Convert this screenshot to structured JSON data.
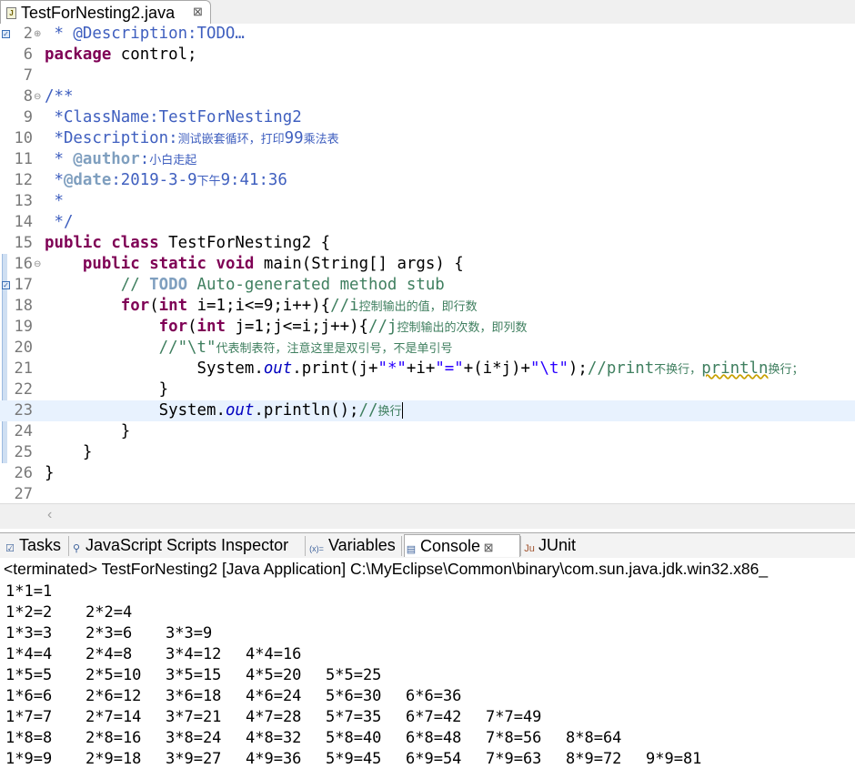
{
  "editor": {
    "tab": {
      "title": "TestForNesting2.java",
      "close": "⊠"
    },
    "lines": [
      {
        "num": "2",
        "fold": "⊕",
        "marker": "task",
        "tokens": [
          {
            "t": " * @Description:TODO",
            "c": "jd"
          },
          {
            "t": "…",
            "c": "jd"
          }
        ]
      },
      {
        "num": "6",
        "tokens": [
          {
            "t": "package",
            "c": "kw"
          },
          {
            "t": " control;",
            "c": ""
          }
        ]
      },
      {
        "num": "7",
        "tokens": []
      },
      {
        "num": "8",
        "fold": "⊖",
        "tokens": [
          {
            "t": "/**",
            "c": "jd"
          }
        ]
      },
      {
        "num": "9",
        "tokens": [
          {
            "t": " *ClassName:TestForNesting2",
            "c": "jd"
          }
        ]
      },
      {
        "num": "10",
        "tokens": [
          {
            "t": " *Description:",
            "c": "jd"
          },
          {
            "t": "测试嵌套循环，打印",
            "c": "jd small"
          },
          {
            "t": "99",
            "c": "jd"
          },
          {
            "t": "乘法表",
            "c": "jd small"
          }
        ]
      },
      {
        "num": "11",
        "tokens": [
          {
            "t": " * ",
            "c": "jd"
          },
          {
            "t": "@author",
            "c": "jdt"
          },
          {
            "t": ":",
            "c": "jd"
          },
          {
            "t": "小白走起",
            "c": "jd small"
          }
        ]
      },
      {
        "num": "12",
        "tokens": [
          {
            "t": " *",
            "c": "jd"
          },
          {
            "t": "@date",
            "c": "jdt"
          },
          {
            "t": ":2019-3-9",
            "c": "jd"
          },
          {
            "t": "下午",
            "c": "jd small"
          },
          {
            "t": "9:41:36",
            "c": "jd"
          }
        ]
      },
      {
        "num": "13",
        "tokens": [
          {
            "t": " *",
            "c": "jd"
          }
        ]
      },
      {
        "num": "14",
        "tokens": [
          {
            "t": " */",
            "c": "jd"
          }
        ]
      },
      {
        "num": "15",
        "tokens": [
          {
            "t": "public",
            "c": "kw"
          },
          {
            "t": " ",
            "c": ""
          },
          {
            "t": "class",
            "c": "kw"
          },
          {
            "t": " TestForNesting2 {",
            "c": ""
          }
        ]
      },
      {
        "num": "16",
        "fold": "⊖",
        "tokens": [
          {
            "t": "    ",
            "c": ""
          },
          {
            "t": "public",
            "c": "kw"
          },
          {
            "t": " ",
            "c": ""
          },
          {
            "t": "static",
            "c": "kw"
          },
          {
            "t": " ",
            "c": ""
          },
          {
            "t": "void",
            "c": "kw"
          },
          {
            "t": " main(String[] args) {",
            "c": ""
          }
        ]
      },
      {
        "num": "17",
        "marker": "task",
        "tokens": [
          {
            "t": "        // ",
            "c": "cm"
          },
          {
            "t": "TODO",
            "c": "jdt"
          },
          {
            "t": " Auto-generated method stub",
            "c": "cm"
          }
        ]
      },
      {
        "num": "18",
        "tokens": [
          {
            "t": "        ",
            "c": ""
          },
          {
            "t": "for",
            "c": "kw"
          },
          {
            "t": "(",
            "c": ""
          },
          {
            "t": "int",
            "c": "kw"
          },
          {
            "t": " i=1;i<=9;i++){",
            "c": ""
          },
          {
            "t": "//i",
            "c": "cm"
          },
          {
            "t": "控制输出的值，即行数",
            "c": "cm small"
          }
        ]
      },
      {
        "num": "19",
        "tokens": [
          {
            "t": "            ",
            "c": ""
          },
          {
            "t": "for",
            "c": "kw"
          },
          {
            "t": "(",
            "c": ""
          },
          {
            "t": "int",
            "c": "kw"
          },
          {
            "t": " j=1;j<=i;j++){",
            "c": ""
          },
          {
            "t": "//j",
            "c": "cm"
          },
          {
            "t": "控制输出的次数，即列数",
            "c": "cm small"
          }
        ]
      },
      {
        "num": "20",
        "tokens": [
          {
            "t": "            //\"\\t\"",
            "c": "cm"
          },
          {
            "t": "代表制表符，注意这里是双引号，不是单引号",
            "c": "cm small"
          }
        ]
      },
      {
        "num": "21",
        "tokens": [
          {
            "t": "                System.",
            "c": ""
          },
          {
            "t": "out",
            "c": "fi"
          },
          {
            "t": ".print(j+",
            "c": ""
          },
          {
            "t": "\"*\"",
            "c": "st"
          },
          {
            "t": "+i+",
            "c": ""
          },
          {
            "t": "\"=\"",
            "c": "st"
          },
          {
            "t": "+(i*j)+",
            "c": ""
          },
          {
            "t": "\"\\t\"",
            "c": "st"
          },
          {
            "t": ");",
            "c": ""
          },
          {
            "t": "//print",
            "c": "cm"
          },
          {
            "t": "不换行，",
            "c": "cm small"
          },
          {
            "t": "println",
            "c": "cm wavy"
          },
          {
            "t": "换行；",
            "c": "cm small"
          }
        ]
      },
      {
        "num": "22",
        "tokens": [
          {
            "t": "            }",
            "c": ""
          }
        ]
      },
      {
        "num": "23",
        "current": true,
        "tokens": [
          {
            "t": "            System.",
            "c": ""
          },
          {
            "t": "out",
            "c": "fi"
          },
          {
            "t": ".println();",
            "c": ""
          },
          {
            "t": "//",
            "c": "cm"
          },
          {
            "t": "换行",
            "c": "cm small"
          }
        ]
      },
      {
        "num": "24",
        "tokens": [
          {
            "t": "        }",
            "c": ""
          }
        ]
      },
      {
        "num": "25",
        "tokens": [
          {
            "t": "    }",
            "c": ""
          }
        ]
      },
      {
        "num": "26",
        "tokens": [
          {
            "t": "}",
            "c": ""
          }
        ]
      },
      {
        "num": "27",
        "tokens": []
      }
    ]
  },
  "views": {
    "tabs": [
      {
        "label": "Tasks",
        "icon": "tasks-icon",
        "glyph": "☑"
      },
      {
        "label": "JavaScript Scripts Inspector",
        "icon": "script-icon",
        "glyph": "⚲"
      },
      {
        "label": "Variables",
        "icon": "variables-icon",
        "glyph": "(x)="
      },
      {
        "label": "Console",
        "icon": "console-icon",
        "glyph": "▤",
        "active": true,
        "close": "⊠"
      },
      {
        "label": "JUnit",
        "icon": "junit-icon",
        "glyph": "Ju"
      }
    ]
  },
  "console": {
    "status": "<terminated> TestForNesting2 [Java Application] C:\\MyEclipse\\Common\\binary\\com.sun.java.jdk.win32.x86_",
    "rows": [
      [
        "1*1=1"
      ],
      [
        "1*2=2",
        "2*2=4"
      ],
      [
        "1*3=3",
        "2*3=6",
        "3*3=9"
      ],
      [
        "1*4=4",
        "2*4=8",
        "3*4=12",
        "4*4=16"
      ],
      [
        "1*5=5",
        "2*5=10",
        "3*5=15",
        "4*5=20",
        "5*5=25"
      ],
      [
        "1*6=6",
        "2*6=12",
        "3*6=18",
        "4*6=24",
        "5*6=30",
        "6*6=36"
      ],
      [
        "1*7=7",
        "2*7=14",
        "3*7=21",
        "4*7=28",
        "5*7=35",
        "6*7=42",
        "7*7=49"
      ],
      [
        "1*8=8",
        "2*8=16",
        "3*8=24",
        "4*8=32",
        "5*8=40",
        "6*8=48",
        "7*8=56",
        "8*8=64"
      ],
      [
        "1*9=9",
        "2*9=18",
        "3*9=27",
        "4*9=36",
        "5*9=45",
        "6*9=54",
        "7*9=63",
        "8*9=72",
        "9*9=81"
      ]
    ]
  },
  "colors": {
    "keyword": "#7f0055",
    "javadoc": "#3f5fbf",
    "javadoc_tag": "#7f9fbf",
    "comment": "#3f7f5f",
    "string": "#2a00ff",
    "field": "#0000c0",
    "current_line": "#e8f2fe"
  }
}
